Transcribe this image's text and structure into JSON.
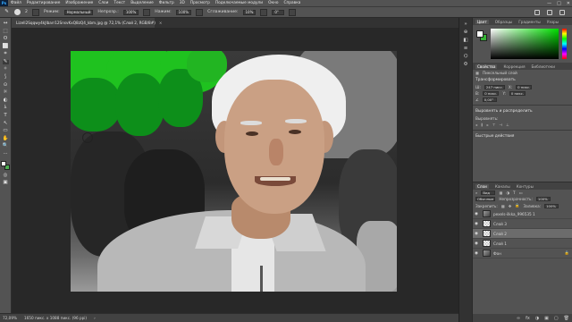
{
  "app": {
    "logo": "Ps"
  },
  "menu": [
    "Файл",
    "Редактирование",
    "Изображение",
    "Слои",
    "Текст",
    "Выделение",
    "Фильтр",
    "3D",
    "Просмотр",
    "Подключаемые модули",
    "Окно",
    "Справка"
  ],
  "window_controls": {
    "minimize": "—",
    "maximize": "□",
    "close": "✕"
  },
  "options": {
    "brush_size": "2",
    "mode_label": "Режим:",
    "mode_value": "Нормальный",
    "opacity_label": "Непрозр.:",
    "opacity_value": "100%",
    "pressure_label": "Нажим:",
    "pressure_value": "100%",
    "smoothing_label": "Сглаживание:",
    "smoothing_value": "10%",
    "angle_value": "0°"
  },
  "document_tab": {
    "title": "Lizell2Sqqwy4kJlbarr12SnsvKxQ8zQ4_kbm.jpg @ 72,1% (Слой 2, RGB/8#)",
    "close": "×"
  },
  "tools": [
    "↔",
    "⬚",
    "ʘ",
    "⬜",
    "⌗",
    "✎",
    "✧",
    "⟆",
    "⊙",
    "☼",
    "◐",
    "ﾑ",
    "T",
    "↖",
    "▭",
    "✋",
    "🔍",
    "···"
  ],
  "status": {
    "zoom": "72,09%",
    "doc_size": "1650 пикс. x 1088 пикс. (96 ppi)",
    "arrow": "›"
  },
  "mid_strip_icons": [
    "»",
    "⊕",
    "◧",
    "≡",
    "⌬",
    "⚙"
  ],
  "right_panel": {
    "color_tabs": [
      "Цвет",
      "Образцы",
      "Градиенты",
      "Узоры"
    ],
    "props_tabs": [
      "Свойства",
      "Коррекция",
      "Библиотеки"
    ],
    "pixel_layer_label": "Пиксельный слой",
    "transform_title": "Трансформировать",
    "w_label": "Ш:",
    "w_value": "247 пикс.",
    "h_label": "В:",
    "h_value": "0 пикс.",
    "x_label": "X:",
    "x_value": "0 пикс.",
    "y_label": "Y:",
    "y_value": "0 пикс.",
    "angle_value": "0,00°",
    "align_title": "Выровнять и распределить",
    "align_sub": "Выровнять:",
    "quick_actions_title": "Быстрые действия"
  },
  "layers": {
    "tabs": [
      "Слои",
      "Каналы",
      "Контуры"
    ],
    "kind_label": "Вид",
    "blend_mode": "Обычные",
    "opacity_label": "Непрозрачность:",
    "opacity_value": "100%",
    "lock_label": "Закрепить:",
    "fill_label": "Заливка:",
    "fill_value": "100%",
    "items": [
      {
        "name": "pexels-ilkka_996535 1",
        "thumb": "photo",
        "visible": true,
        "selected": false
      },
      {
        "name": "Слой 3",
        "thumb": "checker",
        "visible": true,
        "selected": false
      },
      {
        "name": "Слой 2",
        "thumb": "checker",
        "visible": true,
        "selected": true
      },
      {
        "name": "Слой 1",
        "thumb": "checker",
        "visible": true,
        "selected": false
      },
      {
        "name": "Фон",
        "thumb": "photo",
        "visible": true,
        "selected": false
      }
    ],
    "footer_icons": [
      "∞",
      "fx",
      "◑",
      "▣",
      "▢",
      "🗑"
    ]
  },
  "colors": {
    "foreground": "#ffffff",
    "background": "#35b335",
    "accent": "#31a8ff"
  }
}
